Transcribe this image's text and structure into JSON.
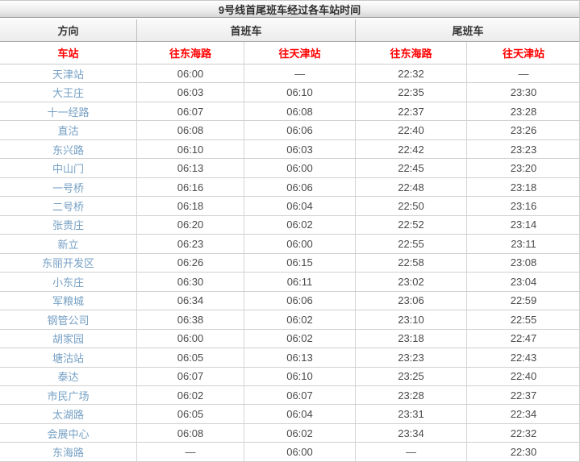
{
  "title": "9号线首尾班车经过各车站时间",
  "colors": {
    "header_red": "#ff0000",
    "station_blue": "#76a0c4",
    "time_text": "#4a4a4a",
    "border": "#cccccc"
  },
  "table": {
    "section_headers": {
      "direction": "方向",
      "first_train": "首班车",
      "last_train": "尾班车"
    },
    "sub_headers": {
      "station": "车站",
      "first_to_donghai": "往东海路",
      "first_to_tianjin": "往天津站",
      "last_to_donghai": "往东海路",
      "last_to_tianjin": "往天津站"
    },
    "empty_value": "—",
    "rows": [
      {
        "station": "天津站",
        "first_donghai": "06:00",
        "first_tianjin": "—",
        "last_donghai": "22:32",
        "last_tianjin": "—"
      },
      {
        "station": "大王庄",
        "first_donghai": "06:03",
        "first_tianjin": "06:10",
        "last_donghai": "22:35",
        "last_tianjin": "23:30"
      },
      {
        "station": "十一经路",
        "first_donghai": "06:07",
        "first_tianjin": "06:08",
        "last_donghai": "22:37",
        "last_tianjin": "23:28"
      },
      {
        "station": "直沽",
        "first_donghai": "06:08",
        "first_tianjin": "06:06",
        "last_donghai": "22:40",
        "last_tianjin": "23:26"
      },
      {
        "station": "东兴路",
        "first_donghai": "06:10",
        "first_tianjin": "06:03",
        "last_donghai": "22:42",
        "last_tianjin": "23:23"
      },
      {
        "station": "中山门",
        "first_donghai": "06:13",
        "first_tianjin": "06:00",
        "last_donghai": "22:45",
        "last_tianjin": "23:20"
      },
      {
        "station": "一号桥",
        "first_donghai": "06:16",
        "first_tianjin": "06:06",
        "last_donghai": "22:48",
        "last_tianjin": "23:18"
      },
      {
        "station": "二号桥",
        "first_donghai": "06:18",
        "first_tianjin": "06:04",
        "last_donghai": "22:50",
        "last_tianjin": "23:16"
      },
      {
        "station": "张贵庄",
        "first_donghai": "06:20",
        "first_tianjin": "06:02",
        "last_donghai": "22:52",
        "last_tianjin": "23:14"
      },
      {
        "station": "新立",
        "first_donghai": "06:23",
        "first_tianjin": "06:00",
        "last_donghai": "22:55",
        "last_tianjin": "23:11"
      },
      {
        "station": "东丽开发区",
        "first_donghai": "06:26",
        "first_tianjin": "06:15",
        "last_donghai": "22:58",
        "last_tianjin": "23:08"
      },
      {
        "station": "小东庄",
        "first_donghai": "06:30",
        "first_tianjin": "06:11",
        "last_donghai": "23:02",
        "last_tianjin": "23:04"
      },
      {
        "station": "军粮城",
        "first_donghai": "06:34",
        "first_tianjin": "06:06",
        "last_donghai": "23:06",
        "last_tianjin": "22:59"
      },
      {
        "station": "钢管公司",
        "first_donghai": "06:38",
        "first_tianjin": "06:02",
        "last_donghai": "23:10",
        "last_tianjin": "22:55"
      },
      {
        "station": "胡家园",
        "first_donghai": "06:00",
        "first_tianjin": "06:02",
        "last_donghai": "23:18",
        "last_tianjin": "22:47"
      },
      {
        "station": "塘沽站",
        "first_donghai": "06:05",
        "first_tianjin": "06:13",
        "last_donghai": "23:23",
        "last_tianjin": "22:43"
      },
      {
        "station": "泰达",
        "first_donghai": "06:07",
        "first_tianjin": "06:10",
        "last_donghai": "23:25",
        "last_tianjin": "22:40"
      },
      {
        "station": "市民广场",
        "first_donghai": "06:02",
        "first_tianjin": "06:07",
        "last_donghai": "23:28",
        "last_tianjin": "22:37"
      },
      {
        "station": "太湖路",
        "first_donghai": "06:05",
        "first_tianjin": "06:04",
        "last_donghai": "23:31",
        "last_tianjin": "22:34"
      },
      {
        "station": "会展中心",
        "first_donghai": "06:08",
        "first_tianjin": "06:02",
        "last_donghai": "23:34",
        "last_tianjin": "22:32"
      },
      {
        "station": "东海路",
        "first_donghai": "—",
        "first_tianjin": "06:00",
        "last_donghai": "—",
        "last_tianjin": "22:30"
      }
    ]
  }
}
